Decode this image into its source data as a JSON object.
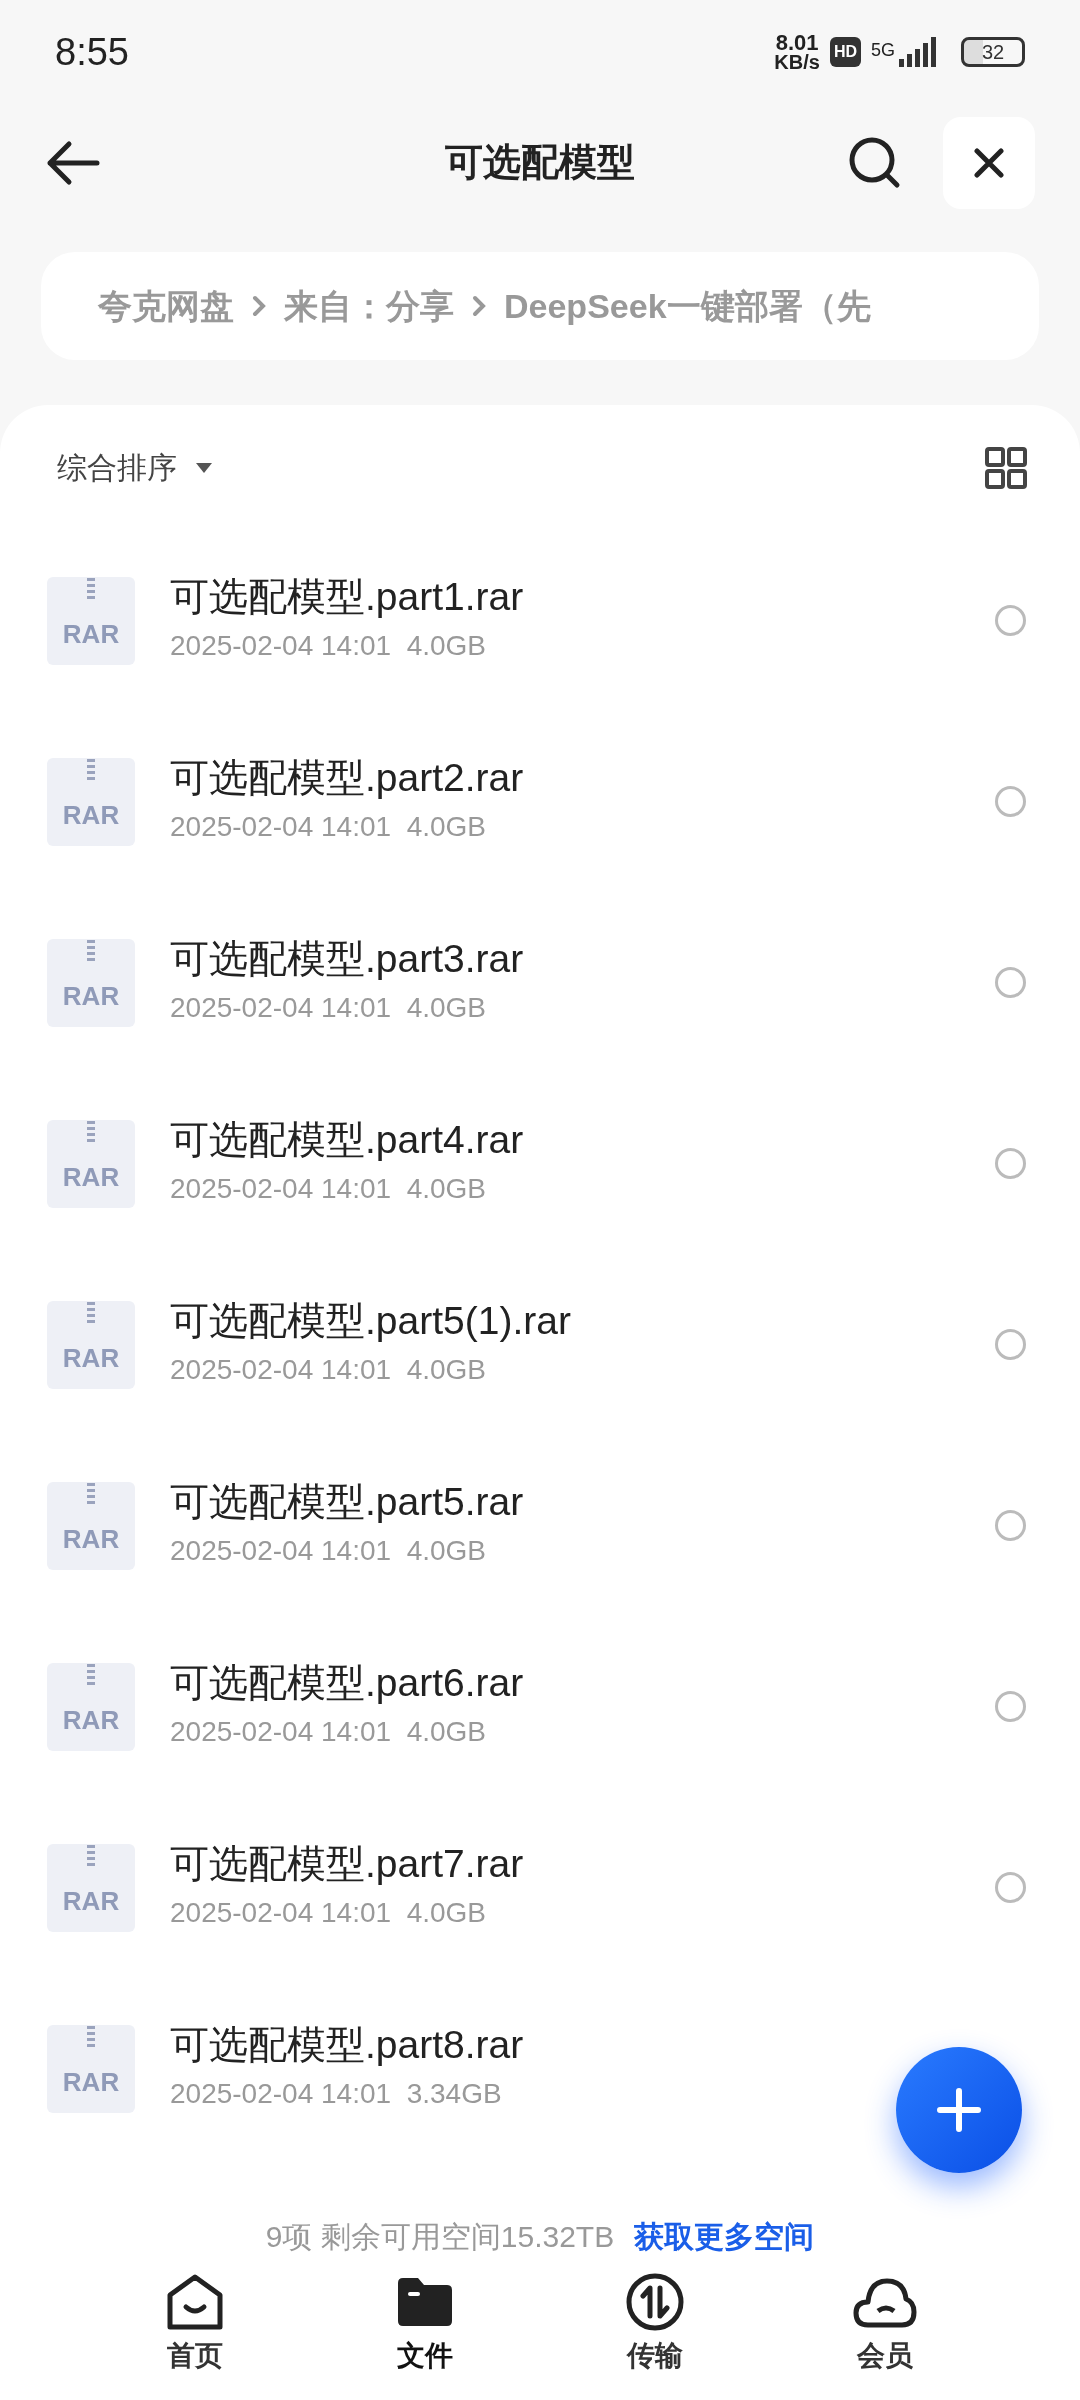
{
  "status_bar": {
    "time": "8:55",
    "speed_value": "8.01",
    "speed_unit": "KB/s",
    "hd": "HD",
    "network": "5G",
    "battery": "32"
  },
  "header": {
    "title": "可选配模型"
  },
  "breadcrumb": [
    "夸克网盘",
    "来自：分享",
    "DeepSeek一键部署（先"
  ],
  "sort": {
    "label": "综合排序"
  },
  "files": [
    {
      "name": "可选配模型.part1.rar",
      "type": "RAR",
      "meta": "2025-02-04 14:01  4.0GB",
      "selected": false
    },
    {
      "name": "可选配模型.part2.rar",
      "type": "RAR",
      "meta": "2025-02-04 14:01  4.0GB",
      "selected": false
    },
    {
      "name": "可选配模型.part3.rar",
      "type": "RAR",
      "meta": "2025-02-04 14:01  4.0GB",
      "selected": false
    },
    {
      "name": "可选配模型.part4.rar",
      "type": "RAR",
      "meta": "2025-02-04 14:01  4.0GB",
      "selected": false
    },
    {
      "name": "可选配模型.part5(1).rar",
      "type": "RAR",
      "meta": "2025-02-04 14:01  4.0GB",
      "selected": false
    },
    {
      "name": "可选配模型.part5.rar",
      "type": "RAR",
      "meta": "2025-02-04 14:01  4.0GB",
      "selected": false
    },
    {
      "name": "可选配模型.part6.rar",
      "type": "RAR",
      "meta": "2025-02-04 14:01  4.0GB",
      "selected": false
    },
    {
      "name": "可选配模型.part7.rar",
      "type": "RAR",
      "meta": "2025-02-04 14:01  4.0GB",
      "selected": false
    },
    {
      "name": "可选配模型.part8.rar",
      "type": "RAR",
      "meta": "2025-02-04 14:01  3.34GB"
    }
  ],
  "footer": {
    "summary": "9项 剩余可用空间15.32TB",
    "link": "获取更多空间"
  },
  "nav": [
    {
      "label": "首页",
      "kind": "home",
      "selected": false
    },
    {
      "label": "文件",
      "kind": "files",
      "selected": true
    },
    {
      "label": "传输",
      "kind": "transfer",
      "selected": false
    },
    {
      "label": "会员",
      "kind": "cloud",
      "selected": false
    }
  ]
}
